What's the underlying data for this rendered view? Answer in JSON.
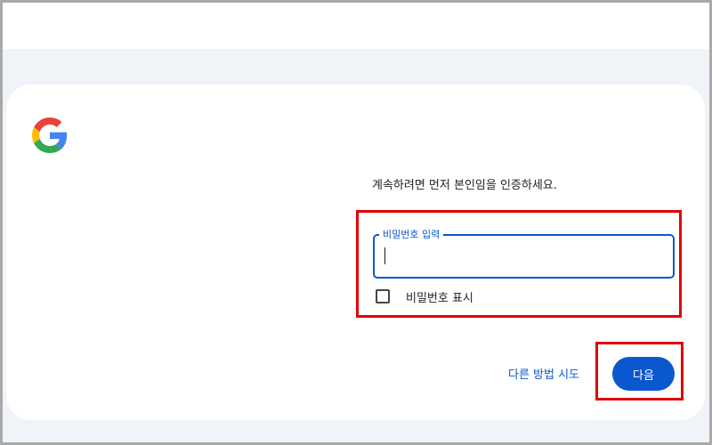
{
  "logo": {
    "icon": "google-g-icon"
  },
  "signin": {
    "prompt": "계속하려면 먼저 본인임을 인증하세요.",
    "password_label": "비밀번호 입력",
    "password_value": "",
    "show_password_label": "비밀번호 표시",
    "show_password_checked": false,
    "try_another_way": "다른 방법 시도",
    "next_label": "다음"
  },
  "colors": {
    "accent": "#0b57d0",
    "page_background": "#f0f4f9",
    "highlight": "#e00000"
  }
}
